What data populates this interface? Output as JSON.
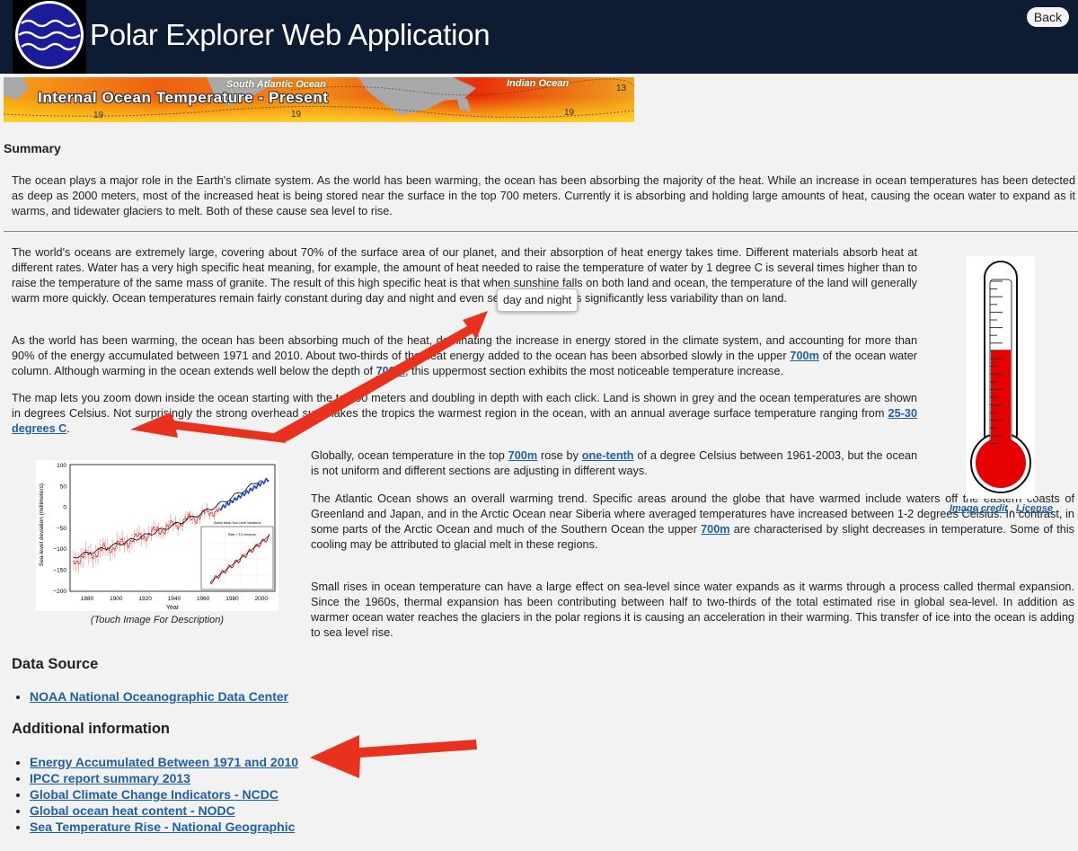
{
  "header": {
    "title": "Polar Explorer Web Application",
    "back_label": "Back"
  },
  "banner": {
    "title": "Internal Ocean Temperature - Present",
    "label_south_atlantic": "South Atlantic Ocean",
    "label_indian": "Indian Ocean",
    "contour_labels": [
      "19",
      "19",
      "19",
      "13"
    ]
  },
  "summary": {
    "heading": "Summary",
    "text": "The ocean plays a major role in the Earth's climate system. As the world has been warming, the ocean has been absorbing the majority of the heat. While an increase in ocean temperatures has been detected as deep as 2000 meters, most of the increased heat is being stored near the surface in the top 700 meters. Currently it is absorbing and holding large amounts of heat, causing the ocean water to expand as it warms, and tidewater glaciers to melt. Both of these cause sea level to rise."
  },
  "body": {
    "p1": "The world's oceans are extremely large, covering about 70% of the surface area of our planet, and their absorption of heat energy takes time. Different materials absorb heat at different rates. Water has a very high specific heat meaning, for example, the amount of heat needed to raise the temperature of water by 1 degree C is several times higher than to raise the temperature of the same mass of granite. The result of this high specific heat is that when sunshine falls on both land and ocean, the temperature of the land will generally warm more quickly. Ocean temperatures remain fairly constant during day and night and even seasonally there is significantly less variability than on land.",
    "p2_a": "As the world has been warming, the ocean has been absorbing much of the heat, dominating the increase in energy stored in the climate system, and accounting for more than 90% of the energy accumulated between 1971 and 2010. About two-thirds of the heat energy added to the ocean has been absorbed slowly in the upper ",
    "p2_link1": "700m",
    "p2_b": " of the ocean water column. Although warming in the ocean extends well below the depth of ",
    "p2_link2": "700m",
    "p2_c": ", this uppermost section exhibits the most noticeable temperature increase.",
    "p3_a": "The map lets you zoom down inside the ocean starting with the top 50 meters and doubling in depth with each click. Land is shown in grey and the ocean temperatures are shown in degrees Celsius. Not surprisingly the strong overhead sun makes the tropics the warmest region in the ocean, with an annual average surface temperature ranging from ",
    "p3_link": "25-30 degrees C",
    "p3_b": ".",
    "p4_a": "Globally, ocean temperature in the top ",
    "p4_link1": "700m",
    "p4_b": " rose by ",
    "p4_link2": "one-tenth",
    "p4_c": " of a degree Celsius between 1961-2003, but the ocean is not uniform and different sections are adjusting in different ways.",
    "p5_a": "The Atlantic Ocean shows an overall warming trend. Specific areas around the globe that have warmed include waters off the eastern coasts of Greenland and Japan, and in the Arctic Ocean near Siberia where averaged temperatures have increased between 1-2 degrees Celsius. In contrast, in some parts of the Arctic Ocean and much of the Southern Ocean the upper ",
    "p5_link": "700m",
    "p5_b": " are characterised by slight decreases in temperature. Some of this cooling may be attributed to glacial melt in these regions.",
    "p6": "Small rises in ocean temperature can have a large effect on sea-level since water expands as it warms through a process called thermal expansion. Since the 1960s, thermal expansion has been contributing between half to two-thirds of the total estimated rise in global sea-level. In addition as warmer ocean water reaches the glaciers in the polar regions it is causing an acceleration in their warming. This transfer of ice into the ocean is adding to sea level rise."
  },
  "tooltip": {
    "text": "day and night"
  },
  "thermometer": {
    "fill_fraction": 0.62,
    "credit_label": "Image credit",
    "separator": ",",
    "license_label": "License"
  },
  "sea_level_chart": {
    "caption": "(Touch Image For Description)",
    "ylabel": "Sea-level deviation (millimeters)",
    "xlabel": "Year",
    "yticks": [
      "100",
      "50",
      "0",
      "−50",
      "−100",
      "−150",
      "−200"
    ],
    "xticks": [
      "1880",
      "1900",
      "1920",
      "1940",
      "1960",
      "1980",
      "2000"
    ],
    "inset_title": "Global Mean Sea Level Variations",
    "inset_note": "Rate = 3.3 mm/year"
  },
  "data_source": {
    "heading": "Data Source",
    "links": [
      "NOAA National Oceanographic Data Center"
    ]
  },
  "additional": {
    "heading": "Additional information",
    "links": [
      "Energy Accumulated Between 1971 and 2010",
      "IPCC report summary 2013",
      "Global Climate Change Indicators - NCDC",
      "Global ocean heat content - NODC",
      "Sea Temperature Rise - National Geographic"
    ]
  },
  "colors": {
    "header_bg": "#0d1b33",
    "link": "#1f5fa6",
    "annotation_arrow": "#e8321e",
    "thermometer_red": "#e60000"
  }
}
